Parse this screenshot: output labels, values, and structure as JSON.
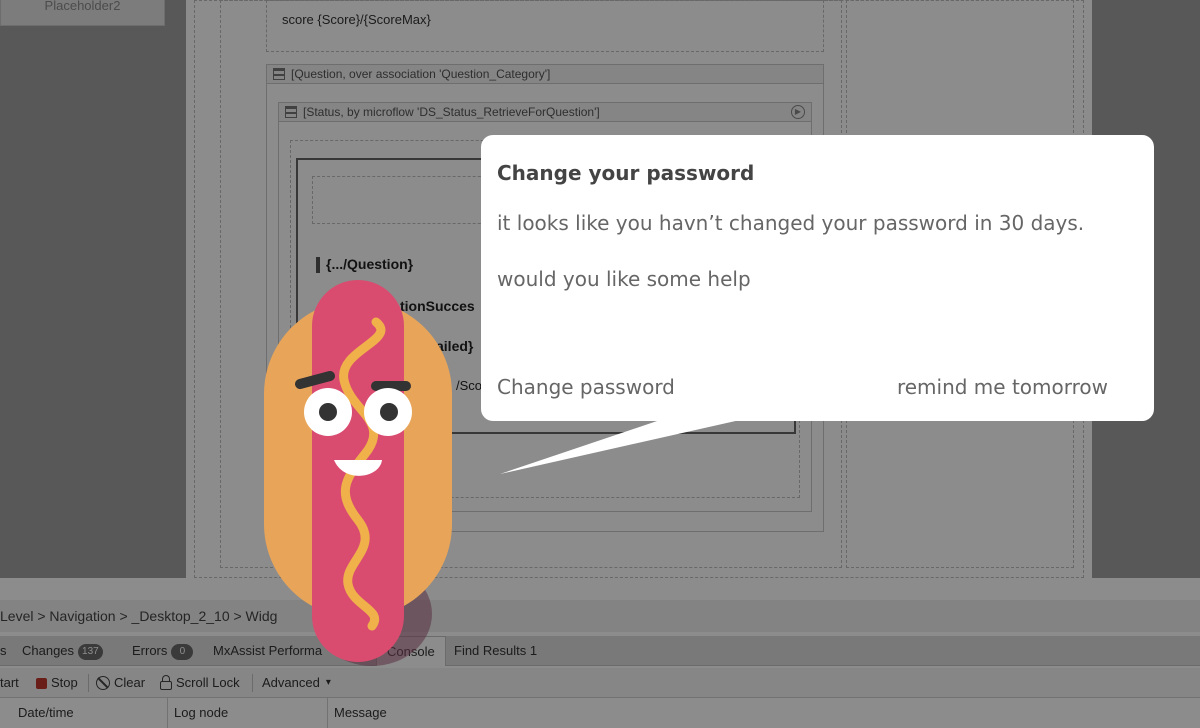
{
  "ide": {
    "placeholder_tab": "Placeholder2",
    "score_text": "score {Score}/{ScoreMax}",
    "question_ds_header": "[Question, over association 'Question_Category']",
    "status_ds_header": "[Status, by microflow 'DS_Status_RetrieveForQuestion']",
    "question_label": "{.../Question}",
    "question_success_label": "tionSucces",
    "failed_label": "ailed}",
    "score_fragment": "/Sco",
    "breadcrumb": "Level > Navigation > _Desktop_2_10 > Widg",
    "tabs": [
      {
        "label": "s"
      },
      {
        "label": "Changes",
        "badge": "137"
      },
      {
        "label": "Errors",
        "badge": "0"
      },
      {
        "label": "MxAssist Performa"
      },
      {
        "label": "Console"
      },
      {
        "label": "Find Results 1"
      }
    ],
    "toolbar": {
      "start": "tart",
      "stop": "Stop",
      "clear": "Clear",
      "scroll_lock": "Scroll Lock",
      "advanced": "Advanced",
      "advanced_caret": "▾"
    },
    "columns": [
      "Date/time",
      "Log node",
      "Message"
    ]
  },
  "bubble": {
    "title": "Change your password",
    "line1": "it looks like you havn’t changed your password in 30 days.",
    "line2": "would you like some help",
    "primary_button": "Change password",
    "secondary_button": "remind me tomorrow"
  },
  "colors": {
    "bun": "#E8A55A",
    "sausage": "#D94C70",
    "mustard": "#F0B14A",
    "eye_white": "#ffffff",
    "brow": "#333333"
  }
}
